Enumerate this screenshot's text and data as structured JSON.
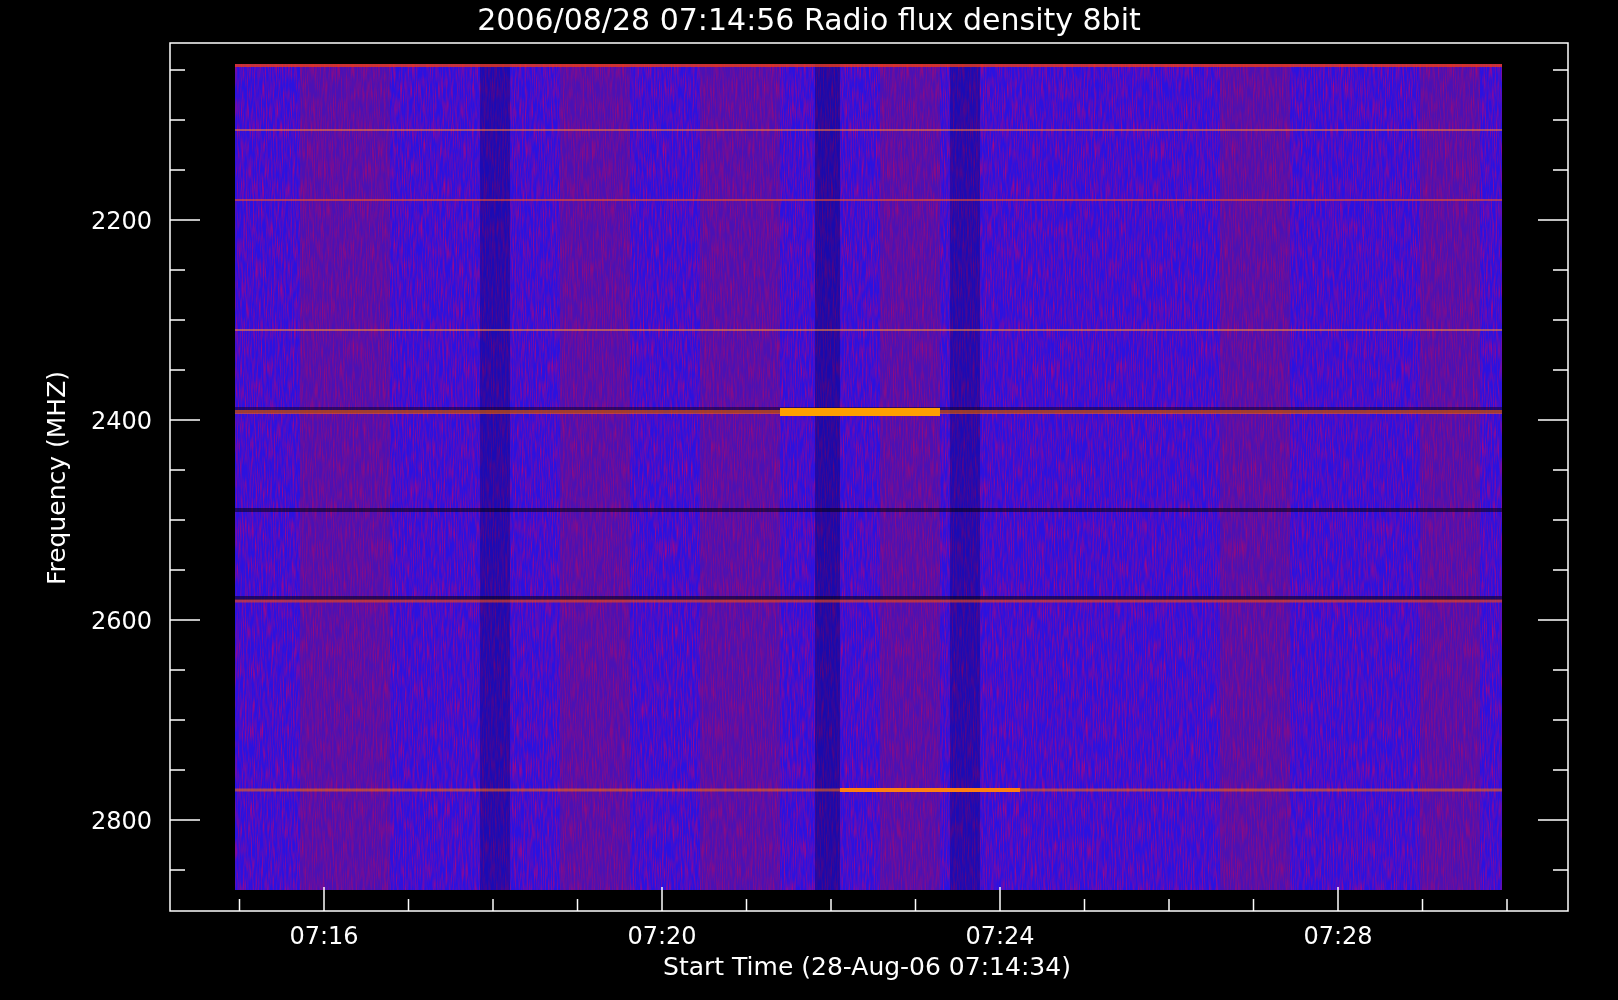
{
  "title": "2006/08/28 07:14:56 Radio flux density 8bit",
  "y_axis": {
    "label": "Frequency (MHZ)",
    "tick_labels": [
      "2200",
      "2400",
      "2600",
      "2800"
    ]
  },
  "x_axis": {
    "label": "Start Time (28-Aug-06 07:14:34)",
    "tick_labels": [
      "07:16",
      "07:20",
      "07:24",
      "07:28"
    ]
  }
}
